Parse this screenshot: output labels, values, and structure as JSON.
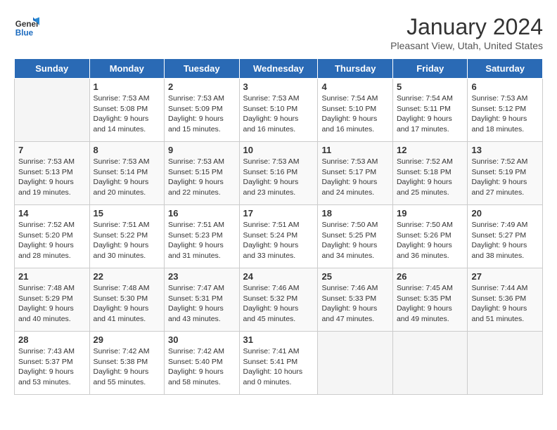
{
  "logo": {
    "general": "General",
    "blue": "Blue"
  },
  "header": {
    "title": "January 2024",
    "subtitle": "Pleasant View, Utah, United States"
  },
  "weekdays": [
    "Sunday",
    "Monday",
    "Tuesday",
    "Wednesday",
    "Thursday",
    "Friday",
    "Saturday"
  ],
  "weeks": [
    [
      {
        "day": "",
        "info": ""
      },
      {
        "day": "1",
        "info": "Sunrise: 7:53 AM\nSunset: 5:08 PM\nDaylight: 9 hours\nand 14 minutes."
      },
      {
        "day": "2",
        "info": "Sunrise: 7:53 AM\nSunset: 5:09 PM\nDaylight: 9 hours\nand 15 minutes."
      },
      {
        "day": "3",
        "info": "Sunrise: 7:53 AM\nSunset: 5:10 PM\nDaylight: 9 hours\nand 16 minutes."
      },
      {
        "day": "4",
        "info": "Sunrise: 7:54 AM\nSunset: 5:10 PM\nDaylight: 9 hours\nand 16 minutes."
      },
      {
        "day": "5",
        "info": "Sunrise: 7:54 AM\nSunset: 5:11 PM\nDaylight: 9 hours\nand 17 minutes."
      },
      {
        "day": "6",
        "info": "Sunrise: 7:53 AM\nSunset: 5:12 PM\nDaylight: 9 hours\nand 18 minutes."
      }
    ],
    [
      {
        "day": "7",
        "info": "Sunrise: 7:53 AM\nSunset: 5:13 PM\nDaylight: 9 hours\nand 19 minutes."
      },
      {
        "day": "8",
        "info": "Sunrise: 7:53 AM\nSunset: 5:14 PM\nDaylight: 9 hours\nand 20 minutes."
      },
      {
        "day": "9",
        "info": "Sunrise: 7:53 AM\nSunset: 5:15 PM\nDaylight: 9 hours\nand 22 minutes."
      },
      {
        "day": "10",
        "info": "Sunrise: 7:53 AM\nSunset: 5:16 PM\nDaylight: 9 hours\nand 23 minutes."
      },
      {
        "day": "11",
        "info": "Sunrise: 7:53 AM\nSunset: 5:17 PM\nDaylight: 9 hours\nand 24 minutes."
      },
      {
        "day": "12",
        "info": "Sunrise: 7:52 AM\nSunset: 5:18 PM\nDaylight: 9 hours\nand 25 minutes."
      },
      {
        "day": "13",
        "info": "Sunrise: 7:52 AM\nSunset: 5:19 PM\nDaylight: 9 hours\nand 27 minutes."
      }
    ],
    [
      {
        "day": "14",
        "info": "Sunrise: 7:52 AM\nSunset: 5:20 PM\nDaylight: 9 hours\nand 28 minutes."
      },
      {
        "day": "15",
        "info": "Sunrise: 7:51 AM\nSunset: 5:22 PM\nDaylight: 9 hours\nand 30 minutes."
      },
      {
        "day": "16",
        "info": "Sunrise: 7:51 AM\nSunset: 5:23 PM\nDaylight: 9 hours\nand 31 minutes."
      },
      {
        "day": "17",
        "info": "Sunrise: 7:51 AM\nSunset: 5:24 PM\nDaylight: 9 hours\nand 33 minutes."
      },
      {
        "day": "18",
        "info": "Sunrise: 7:50 AM\nSunset: 5:25 PM\nDaylight: 9 hours\nand 34 minutes."
      },
      {
        "day": "19",
        "info": "Sunrise: 7:50 AM\nSunset: 5:26 PM\nDaylight: 9 hours\nand 36 minutes."
      },
      {
        "day": "20",
        "info": "Sunrise: 7:49 AM\nSunset: 5:27 PM\nDaylight: 9 hours\nand 38 minutes."
      }
    ],
    [
      {
        "day": "21",
        "info": "Sunrise: 7:48 AM\nSunset: 5:29 PM\nDaylight: 9 hours\nand 40 minutes."
      },
      {
        "day": "22",
        "info": "Sunrise: 7:48 AM\nSunset: 5:30 PM\nDaylight: 9 hours\nand 41 minutes."
      },
      {
        "day": "23",
        "info": "Sunrise: 7:47 AM\nSunset: 5:31 PM\nDaylight: 9 hours\nand 43 minutes."
      },
      {
        "day": "24",
        "info": "Sunrise: 7:46 AM\nSunset: 5:32 PM\nDaylight: 9 hours\nand 45 minutes."
      },
      {
        "day": "25",
        "info": "Sunrise: 7:46 AM\nSunset: 5:33 PM\nDaylight: 9 hours\nand 47 minutes."
      },
      {
        "day": "26",
        "info": "Sunrise: 7:45 AM\nSunset: 5:35 PM\nDaylight: 9 hours\nand 49 minutes."
      },
      {
        "day": "27",
        "info": "Sunrise: 7:44 AM\nSunset: 5:36 PM\nDaylight: 9 hours\nand 51 minutes."
      }
    ],
    [
      {
        "day": "28",
        "info": "Sunrise: 7:43 AM\nSunset: 5:37 PM\nDaylight: 9 hours\nand 53 minutes."
      },
      {
        "day": "29",
        "info": "Sunrise: 7:42 AM\nSunset: 5:38 PM\nDaylight: 9 hours\nand 55 minutes."
      },
      {
        "day": "30",
        "info": "Sunrise: 7:42 AM\nSunset: 5:40 PM\nDaylight: 9 hours\nand 58 minutes."
      },
      {
        "day": "31",
        "info": "Sunrise: 7:41 AM\nSunset: 5:41 PM\nDaylight: 10 hours\nand 0 minutes."
      },
      {
        "day": "",
        "info": ""
      },
      {
        "day": "",
        "info": ""
      },
      {
        "day": "",
        "info": ""
      }
    ]
  ]
}
